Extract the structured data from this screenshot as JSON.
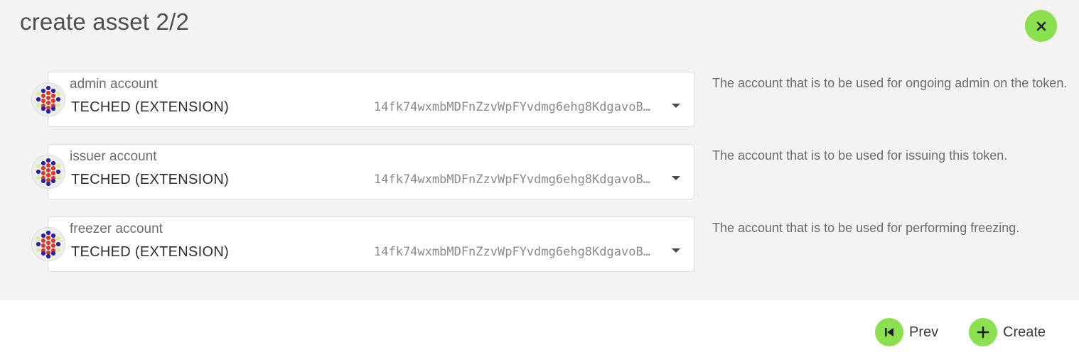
{
  "modal": {
    "title": "create asset 2/2",
    "close_icon": "close-icon"
  },
  "accounts": [
    {
      "label": "admin account",
      "name": "TECHED (EXTENSION)",
      "address": "14fk74wxmbMDFnZzvWpFYvdmg6ehg8KdgavoB…",
      "help": "The account that is to be used for ongoing admin on the token."
    },
    {
      "label": "issuer account",
      "name": "TECHED (EXTENSION)",
      "address": "14fk74wxmbMDFnZzvWpFYvdmg6ehg8KdgavoB…",
      "help": "The account that is to be used for issuing this token."
    },
    {
      "label": "freezer account",
      "name": "TECHED (EXTENSION)",
      "address": "14fk74wxmbMDFnZzvWpFYvdmg6ehg8KdgavoB…",
      "help": "The account that is to be used for performing freezing."
    }
  ],
  "footer": {
    "prev_label": "Prev",
    "create_label": "Create"
  },
  "colors": {
    "accent": "#8ae04e",
    "body_bg": "#f4f3f2"
  }
}
